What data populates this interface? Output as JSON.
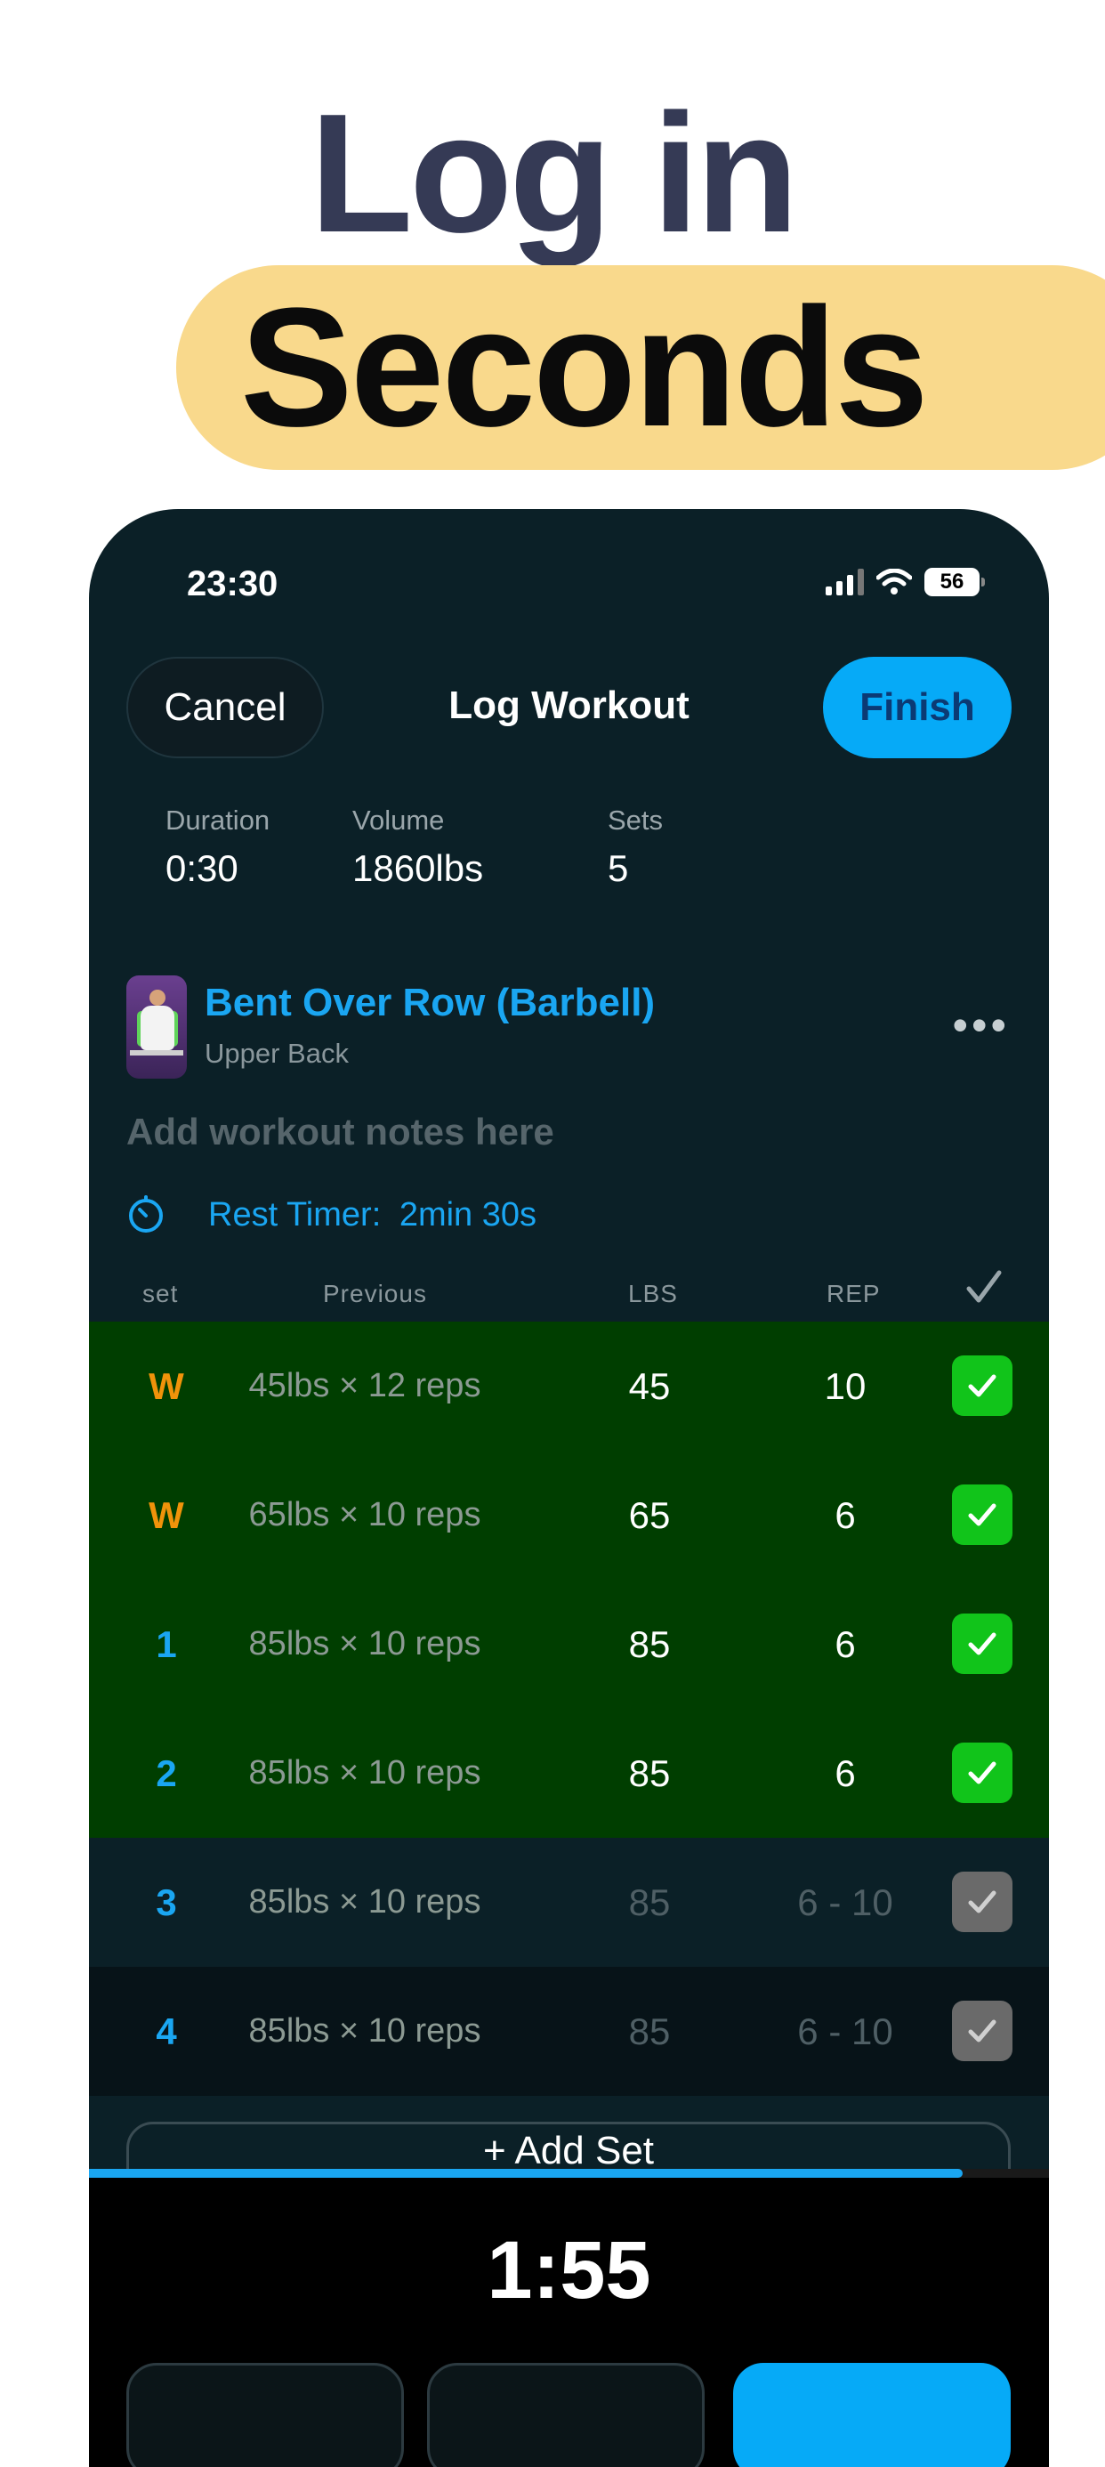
{
  "headline": {
    "line1": "Log in",
    "line2": "Seconds"
  },
  "status_bar": {
    "time": "23:30",
    "battery": "56"
  },
  "nav": {
    "cancel_label": "Cancel",
    "title": "Log Workout",
    "finish_label": "Finish"
  },
  "stats": [
    {
      "label": "Duration",
      "value": "0:30"
    },
    {
      "label": "Volume",
      "value": "1860lbs"
    },
    {
      "label": "Sets",
      "value": "5"
    }
  ],
  "exercise": {
    "name": "Bent Over Row (Barbell)",
    "muscle": "Upper Back",
    "notes_placeholder": "Add workout notes here",
    "more": "•••",
    "rest_timer_label": "Rest Timer:",
    "rest_timer_value": "2min 30s"
  },
  "table": {
    "headers": {
      "set": "set",
      "previous": "Previous",
      "lbs": "LBS",
      "rep": "REP"
    },
    "rows": [
      {
        "set": "W",
        "previous": "45lbs × 12 reps",
        "lbs": "45",
        "rep": "10",
        "done": true
      },
      {
        "set": "W",
        "previous": "65lbs × 10 reps",
        "lbs": "65",
        "rep": "6",
        "done": true
      },
      {
        "set": "1",
        "previous": "85lbs × 10 reps",
        "lbs": "85",
        "rep": "6",
        "done": true
      },
      {
        "set": "2",
        "previous": "85lbs × 10 reps",
        "lbs": "85",
        "rep": "6",
        "done": true
      },
      {
        "set": "3",
        "previous": "85lbs × 10 reps",
        "lbs": "85",
        "rep": "6 - 10",
        "done": false
      },
      {
        "set": "4",
        "previous": "85lbs × 10 reps",
        "lbs": "85",
        "rep": "6 - 10",
        "done": false
      }
    ]
  },
  "add_set_label": "+ Add Set",
  "rest_timer": {
    "remaining": "1:55",
    "progress": 0.91
  },
  "colors": {
    "accent": "#06aaf7",
    "warmup": "#f0930a",
    "working_set": "#1aa6f2",
    "done_row": "#003e00",
    "checkbox_done": "#11c41a",
    "pill": "#f9d98c"
  }
}
